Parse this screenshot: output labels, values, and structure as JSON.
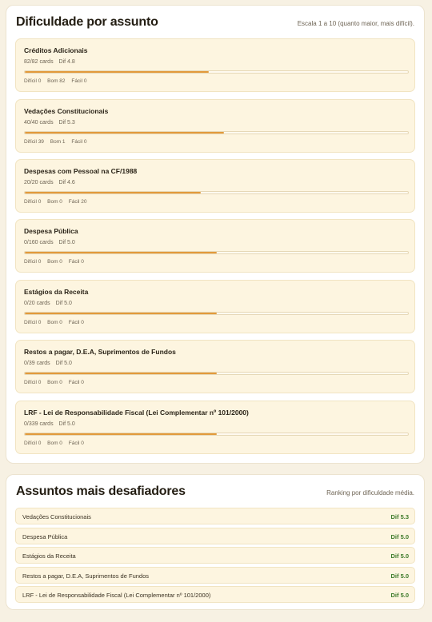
{
  "difficulty_section": {
    "title": "Dificuldade por assunto",
    "subtitle": "Escala 1 a 10 (quanto maior, mais difícil).",
    "subjects": [
      {
        "name": "Créditos Adicionais",
        "cards": "82/82 cards",
        "dif": "Dif 4.8",
        "progress": 0.48,
        "dificil": "Difícil 0",
        "bom": "Bom 82",
        "facil": "Fácil 0"
      },
      {
        "name": "Vedações Constitucionais",
        "cards": "40/40 cards",
        "dif": "Dif 5.3",
        "progress": 0.52,
        "dificil": "Difícil 39",
        "bom": "Bom 1",
        "facil": "Fácil 0"
      },
      {
        "name": "Despesas com Pessoal na CF/1988",
        "cards": "20/20 cards",
        "dif": "Dif 4.6",
        "progress": 0.46,
        "dificil": "Difícil 0",
        "bom": "Bom 0",
        "facil": "Fácil 20"
      },
      {
        "name": "Despesa Pública",
        "cards": "0/160 cards",
        "dif": "Dif 5.0",
        "progress": 0.5,
        "dificil": "Difícil 0",
        "bom": "Bom 0",
        "facil": "Fácil 0"
      },
      {
        "name": "Estágios da Receita",
        "cards": "0/20 cards",
        "dif": "Dif 5.0",
        "progress": 0.5,
        "dificil": "Difícil 0",
        "bom": "Bom 0",
        "facil": "Fácil 0"
      },
      {
        "name": "Restos a pagar, D.E.A, Suprimentos de Fundos",
        "cards": "0/39 cards",
        "dif": "Dif 5.0",
        "progress": 0.5,
        "dificil": "Difícil 0",
        "bom": "Bom 0",
        "facil": "Fácil 0"
      },
      {
        "name": "LRF - Lei de Responsabilidade Fiscal (Lei Complementar nº 101/2000)",
        "cards": "0/339 cards",
        "dif": "Dif 5.0",
        "progress": 0.5,
        "dificil": "Difícil 0",
        "bom": "Bom 0",
        "facil": "Fácil 0"
      }
    ]
  },
  "challenging_section": {
    "title": "Assuntos mais desafiadores",
    "subtitle": "Ranking por dificuldade média.",
    "items": [
      {
        "name": "Vedações Constitucionais",
        "score": "Dif 5.3"
      },
      {
        "name": "Despesa Pública",
        "score": "Dif 5.0"
      },
      {
        "name": "Estágios da Receita",
        "score": "Dif 5.0"
      },
      {
        "name": "Restos a pagar, D.E.A, Suprimentos de Fundos",
        "score": "Dif 5.0"
      },
      {
        "name": "LRF - Lei de Responsabilidade Fiscal (Lei Complementar nº 101/2000)",
        "score": "Dif 5.0"
      }
    ]
  },
  "colors": {
    "page_background": "#f7f1e3",
    "item_background": "#fdf5e0",
    "progress_fill": "#e29a3b",
    "score_green": "#3d7a2a"
  }
}
